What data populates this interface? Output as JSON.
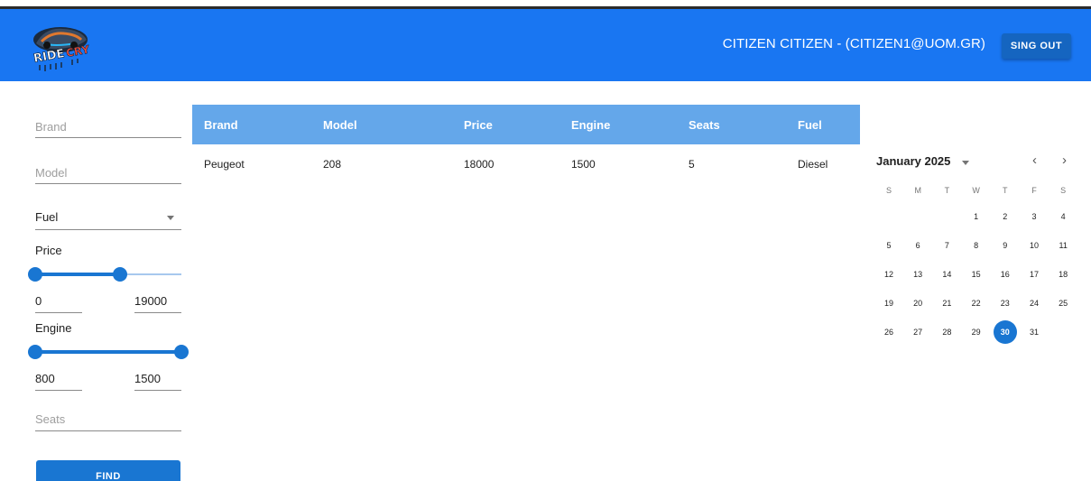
{
  "header": {
    "logo_text": "RIDE CRY",
    "user_label": "CITIZEN CITIZEN - (CITIZEN1@UOM.GR)",
    "signout_label": "SING OUT",
    "bar_color": "#1976f2"
  },
  "filters": {
    "brand_placeholder": "Brand",
    "model_placeholder": "Model",
    "fuel_label": "Fuel",
    "price_label": "Price",
    "price_min": "0",
    "price_max": "19000",
    "price_slider_low_fraction": 0,
    "price_slider_high_fraction": 0.58,
    "engine_label": "Engine",
    "engine_min": "800",
    "engine_max": "1500",
    "engine_slider_low_fraction": 0,
    "engine_slider_high_fraction": 1,
    "seats_placeholder": "Seats",
    "find_label": "FIND"
  },
  "table": {
    "columns": [
      "Brand",
      "Model",
      "Price",
      "Engine",
      "Seats",
      "Fuel"
    ],
    "rows": [
      [
        "Peugeot",
        "208",
        "18000",
        "1500",
        "5",
        "Diesel"
      ]
    ]
  },
  "calendar": {
    "month_label": "January 2025",
    "weekdays": [
      "S",
      "M",
      "T",
      "W",
      "T",
      "F",
      "S"
    ],
    "first_weekday_index": 3,
    "days_in_month": 31,
    "selected_day": 30,
    "prev_icon": "chevron-left-icon",
    "next_icon": "chevron-right-icon",
    "accent": "#1976d2"
  }
}
